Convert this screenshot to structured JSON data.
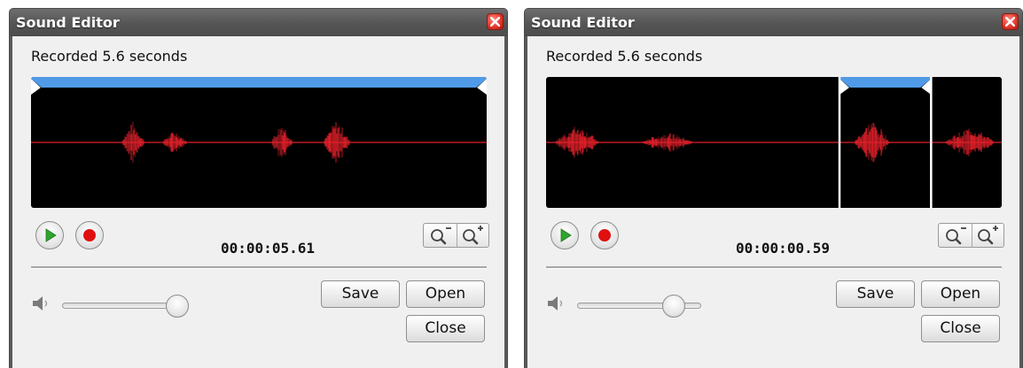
{
  "dialogs": [
    {
      "title": "Sound Editor",
      "status": "Recorded 5.6 seconds",
      "timecode": "00:00:05.61",
      "buttons": {
        "save": "Save",
        "open": "Open",
        "close": "Close"
      },
      "icons": [
        "close-icon",
        "play-icon",
        "record-icon",
        "zoom-out-icon",
        "zoom-in-icon",
        "speaker-icon"
      ],
      "selection": {
        "start_fraction": 0.0,
        "end_fraction": 1.0
      },
      "volume_fraction": 0.93
    },
    {
      "title": "Sound Editor",
      "status": "Recorded 5.6 seconds",
      "timecode": "00:00:00.59",
      "buttons": {
        "save": "Save",
        "open": "Open",
        "close": "Close"
      },
      "icons": [
        "close-icon",
        "play-icon",
        "record-icon",
        "zoom-out-icon",
        "zoom-in-icon",
        "speaker-icon"
      ],
      "selection": {
        "start_fraction": 0.644,
        "end_fraction": 0.845
      },
      "volume_fraction": 0.78
    }
  ],
  "colors": {
    "titlebar": "#5a5a5a",
    "waveform_bg": "#000000",
    "waveform": "#e0202a",
    "selection": "#4f9be8",
    "play": "#2fa52f",
    "record": "#e01010"
  }
}
